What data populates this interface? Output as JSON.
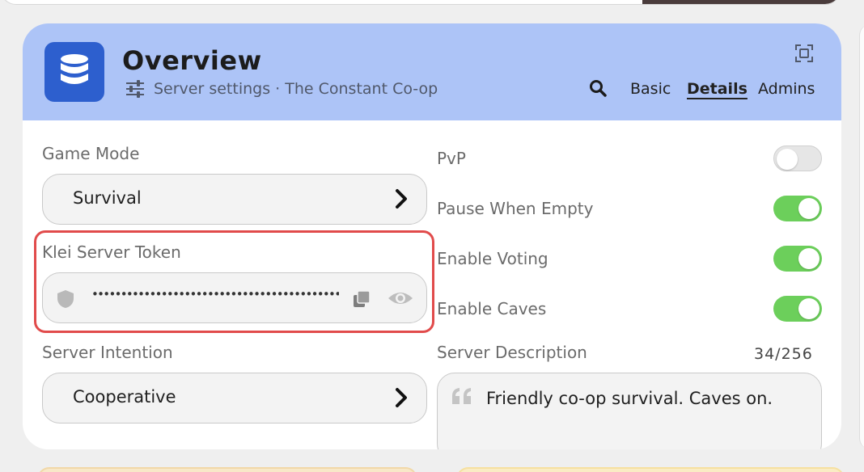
{
  "header": {
    "title": "Overview",
    "subtitle": "Server settings · The Constant Co-op",
    "tabs": [
      "Basic",
      "Details",
      "Admins"
    ],
    "active_tab": "Details",
    "accent_color": "#adc4f7",
    "app_icon_color": "#2d5fce"
  },
  "left": {
    "game_mode": {
      "label": "Game Mode",
      "value": "Survival"
    },
    "token": {
      "label": "Klei Server Token",
      "masked_value": "••••••••••••••••••••••••••••••••••••••••••••••••••••••••••••"
    },
    "intention": {
      "label": "Server Intention",
      "value": "Cooperative"
    }
  },
  "right": {
    "toggles": [
      {
        "label": "PvP",
        "on": false
      },
      {
        "label": "Pause When Empty",
        "on": true
      },
      {
        "label": "Enable Voting",
        "on": true
      },
      {
        "label": "Enable Caves",
        "on": true
      }
    ],
    "description": {
      "label": "Server Description",
      "counter": "34/256",
      "value": "Friendly co-op survival. Caves on."
    }
  },
  "colors": {
    "toggle_on": "#6ccf5b",
    "highlight": "#e14b4b"
  },
  "icons": [
    "database-icon",
    "sliders-icon",
    "expand-icon",
    "search-icon",
    "chevron-right-icon",
    "shield-icon",
    "copy-icon",
    "eye-icon",
    "quote-icon"
  ]
}
